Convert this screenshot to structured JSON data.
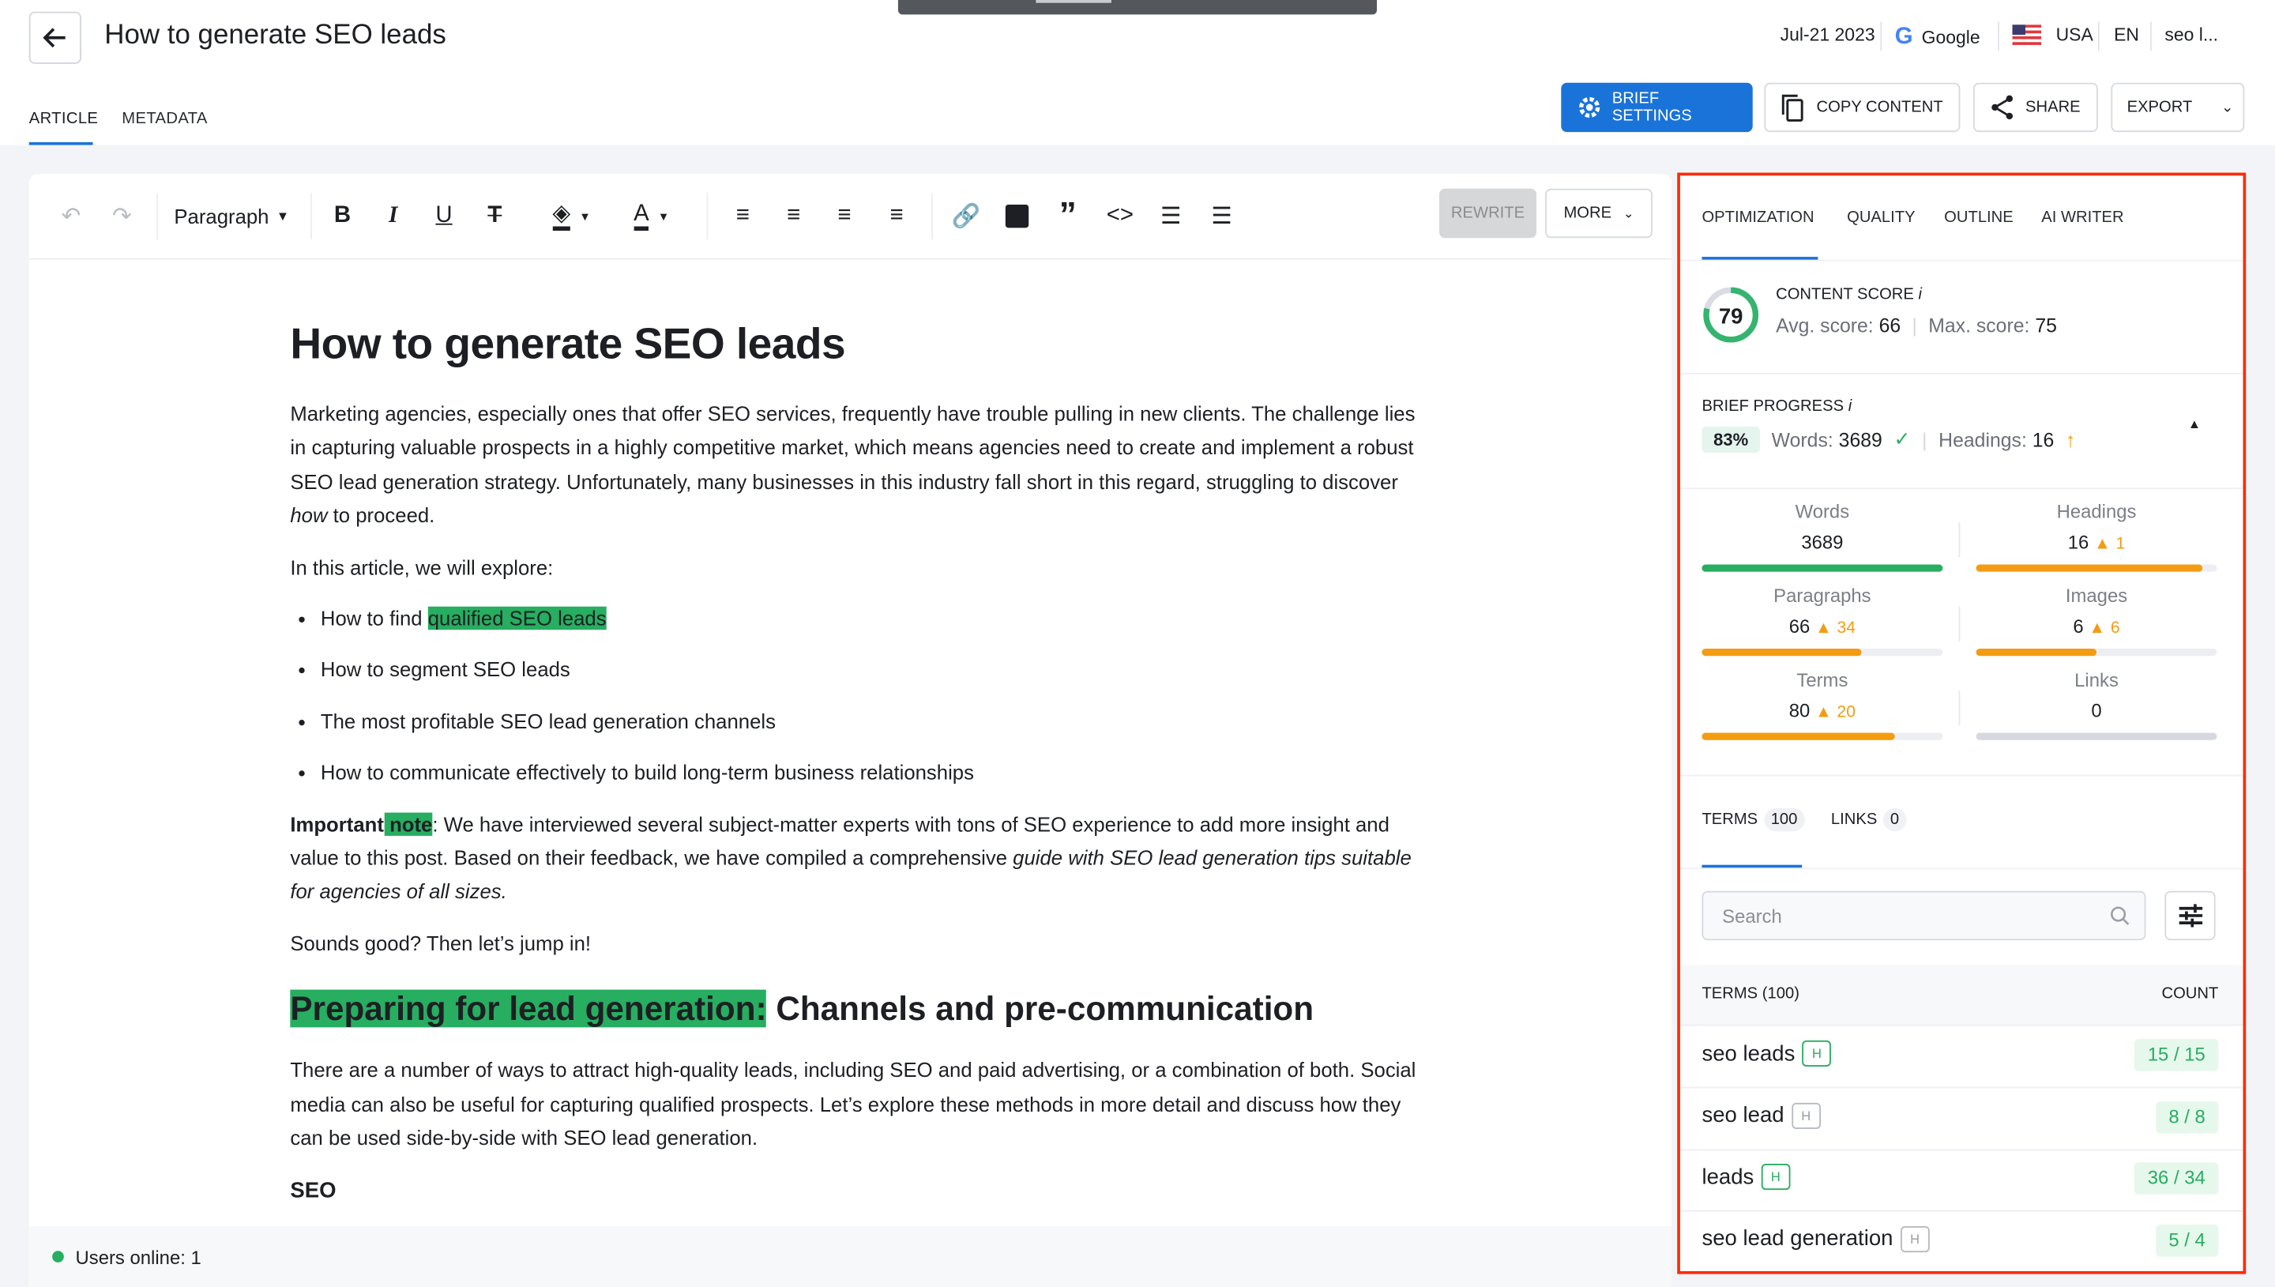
{
  "header": {
    "title": "How to generate SEO leads",
    "date": "Jul-21 2023",
    "search_engine": "Google",
    "country": "USA",
    "language": "EN",
    "keyword": "seo l...",
    "tabs": [
      {
        "label": "ARTICLE",
        "active": true
      },
      {
        "label": "METADATA",
        "active": false
      }
    ],
    "buttons": {
      "brief_settings": "BRIEF SETTINGS",
      "copy_content": "COPY CONTENT",
      "share": "SHARE",
      "export": "EXPORT"
    }
  },
  "colors": {
    "accent": "#1a73d9",
    "highlight": "#27ae60",
    "warning": "#f39c12",
    "panel_outline": "#ff2a00"
  },
  "toolbar": {
    "block_format": "Paragraph",
    "rewrite": "REWRITE",
    "more": "MORE",
    "icons": [
      "undo-icon",
      "redo-icon",
      "bold-icon",
      "italic-icon",
      "underline-icon",
      "strikethrough-icon",
      "fill-color-icon",
      "text-color-icon",
      "align-left-icon",
      "align-center-icon",
      "align-right-icon",
      "align-justify-icon",
      "link-icon",
      "image-icon",
      "quote-icon",
      "code-icon",
      "bullet-list-icon",
      "numbered-list-icon"
    ]
  },
  "article": {
    "h1": "How to generate SEO leads",
    "p1": "Marketing agencies, especially ones that offer SEO services, frequently have trouble pulling in new clients. The challenge lies in capturing valuable prospects in a highly competitive market, which means agencies need to create and implement a robust SEO lead generation strategy. Unfortunately, many businesses in this industry fall short in this regard, struggling to discover ",
    "p1_italic": "how",
    "p1_end": " to proceed.",
    "p2": "In this article, we will explore:",
    "list": [
      {
        "text": "How to find ",
        "highlight": "qualified SEO leads"
      },
      {
        "text": "How to segment SEO leads"
      },
      {
        "text": "The most profitable SEO lead generation channels"
      },
      {
        "text": "How to communicate effectively to build long-term business relationships"
      }
    ],
    "note_bold": "Important",
    "note_highlight": " note",
    "note_text": ": We have interviewed several subject-matter experts with tons of SEO experience to add more insight and value to this post. Based on their feedback, we have compiled a comprehensive ",
    "note_italic": "guide with SEO lead generation tips suitable for agencies of all sizes.",
    "p4": "Sounds good? Then let’s jump in!",
    "h2_highlight": "Preparing for lead generation:",
    "h2_rest": " Channels and pre-communication",
    "p5": "There are a number of ways to attract high-quality leads, including SEO and paid advertising, or a combination of both. Social media can also be useful for capturing qualified prospects. Let’s explore these methods in more detail and discuss how they can be used side-by-side with SEO lead generation.",
    "h3": "SEO"
  },
  "footer": {
    "users_online": "Users online: 1"
  },
  "panel": {
    "tabs": [
      "OPTIMIZATION",
      "QUALITY",
      "OUTLINE",
      "AI WRITER"
    ],
    "active_tab": "OPTIMIZATION",
    "content_score": {
      "label": "CONTENT SCORE",
      "info": "i",
      "score": "79",
      "score_value": 79,
      "avg_label": "Avg. score:",
      "avg": "66",
      "max_label": "Max. score:",
      "max": "75"
    },
    "brief_progress": {
      "label": "BRIEF PROGRESS",
      "info": "i",
      "percent": "83%",
      "words_label": "Words:",
      "words": "3689",
      "headings_label": "Headings:",
      "headings": "16"
    },
    "metrics": [
      {
        "label": "Words",
        "value": "3689",
        "delta": "",
        "progress": 1.0,
        "color": "#27ae60"
      },
      {
        "label": "Headings",
        "value": "16",
        "delta": "1",
        "progress": 0.94,
        "color": "#f39c12"
      },
      {
        "label": "Paragraphs",
        "value": "66",
        "delta": "34",
        "progress": 0.66,
        "color": "#f39c12"
      },
      {
        "label": "Images",
        "value": "6",
        "delta": "6",
        "progress": 0.5,
        "color": "#f39c12"
      },
      {
        "label": "Terms",
        "value": "80",
        "delta": "20",
        "progress": 0.8,
        "color": "#f39c12"
      },
      {
        "label": "Links",
        "value": "0",
        "delta": "",
        "progress": 0,
        "color": "#d5d8de"
      }
    ],
    "subtabs": [
      {
        "label": "TERMS",
        "count": "100"
      },
      {
        "label": "LINKS",
        "count": "0"
      }
    ],
    "search_placeholder": "Search",
    "table": {
      "col_terms": "TERMS (100)",
      "col_count": "COUNT",
      "rows": [
        {
          "term": "seo leads",
          "h": "H",
          "h_used": true,
          "count": "15 / 15"
        },
        {
          "term": "seo lead",
          "h": "H",
          "h_used": false,
          "count": "8 / 8"
        },
        {
          "term": "leads",
          "h": "H",
          "h_used": true,
          "count": "36 / 34"
        },
        {
          "term": "seo lead generation",
          "h": "H",
          "h_used": false,
          "count": "5 / 4"
        }
      ]
    }
  }
}
